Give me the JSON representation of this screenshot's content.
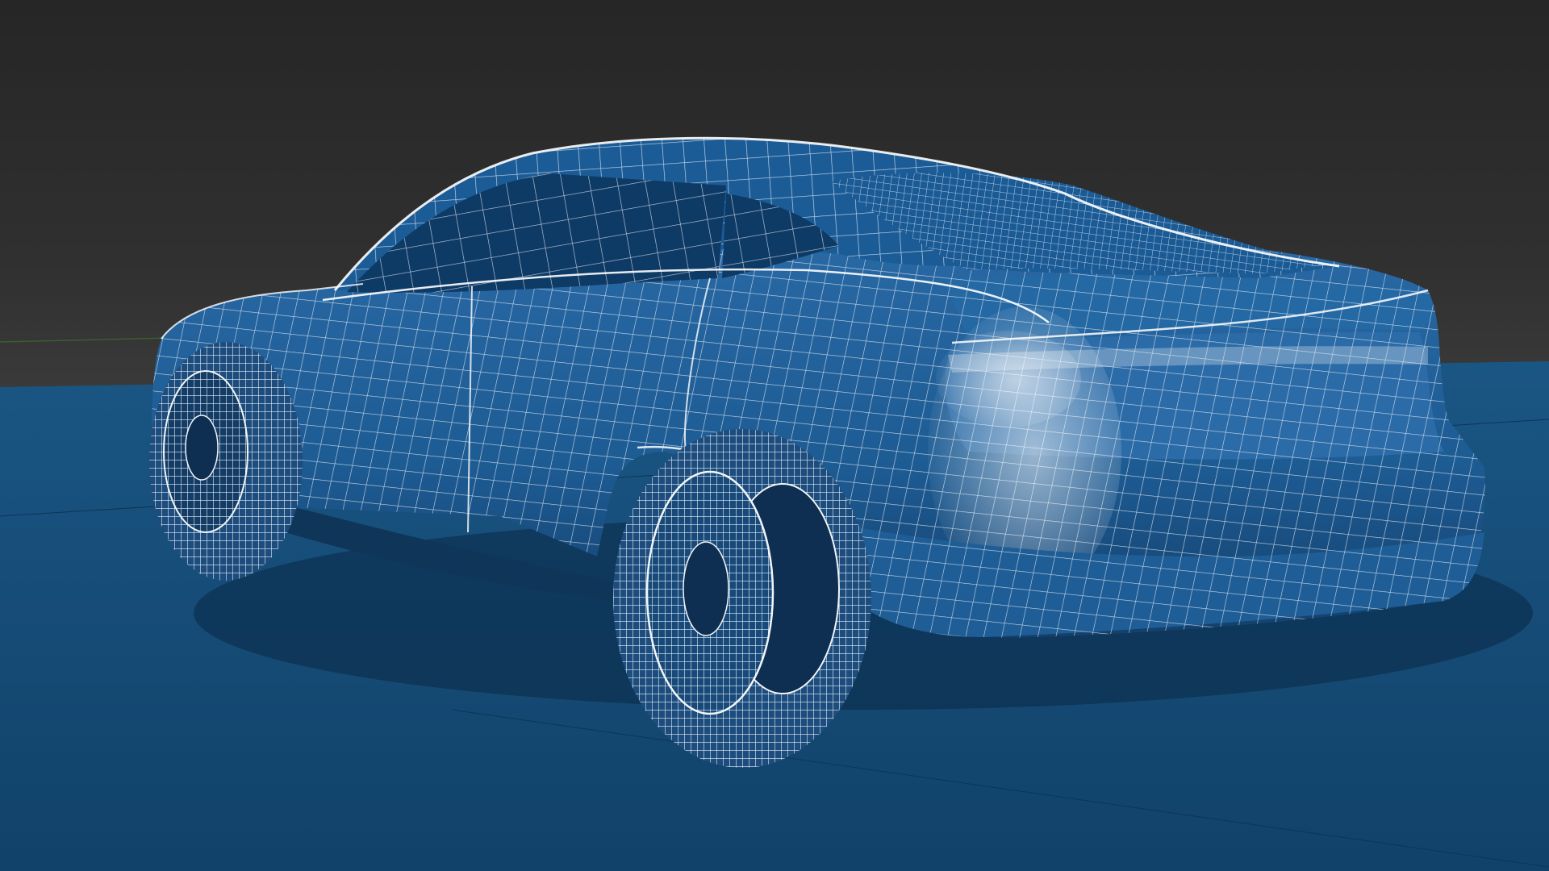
{
  "viewport": {
    "label": "",
    "shading": "wireframe-overlay-on-solid",
    "colors": {
      "background_top": "#262626",
      "background_bottom": "#3d3d3d",
      "ground": "#134a72",
      "ground_far": "#1a5684",
      "car_body": "#1d5b93",
      "car_body_dark": "#123f6a",
      "wire": "#e8eef5",
      "wheel_inner": "#0f2f52",
      "axis_x": "#8a2f2f",
      "axis_y": "#3f6e2f"
    }
  },
  "model": {
    "object": "car-wireframe",
    "view": "rear-three-quarter",
    "parts": [
      "body",
      "rear-window",
      "side-window",
      "roof",
      "trunk-lid",
      "taillight",
      "rear-bumper",
      "rear-left-wheel",
      "front-left-wheel"
    ]
  }
}
